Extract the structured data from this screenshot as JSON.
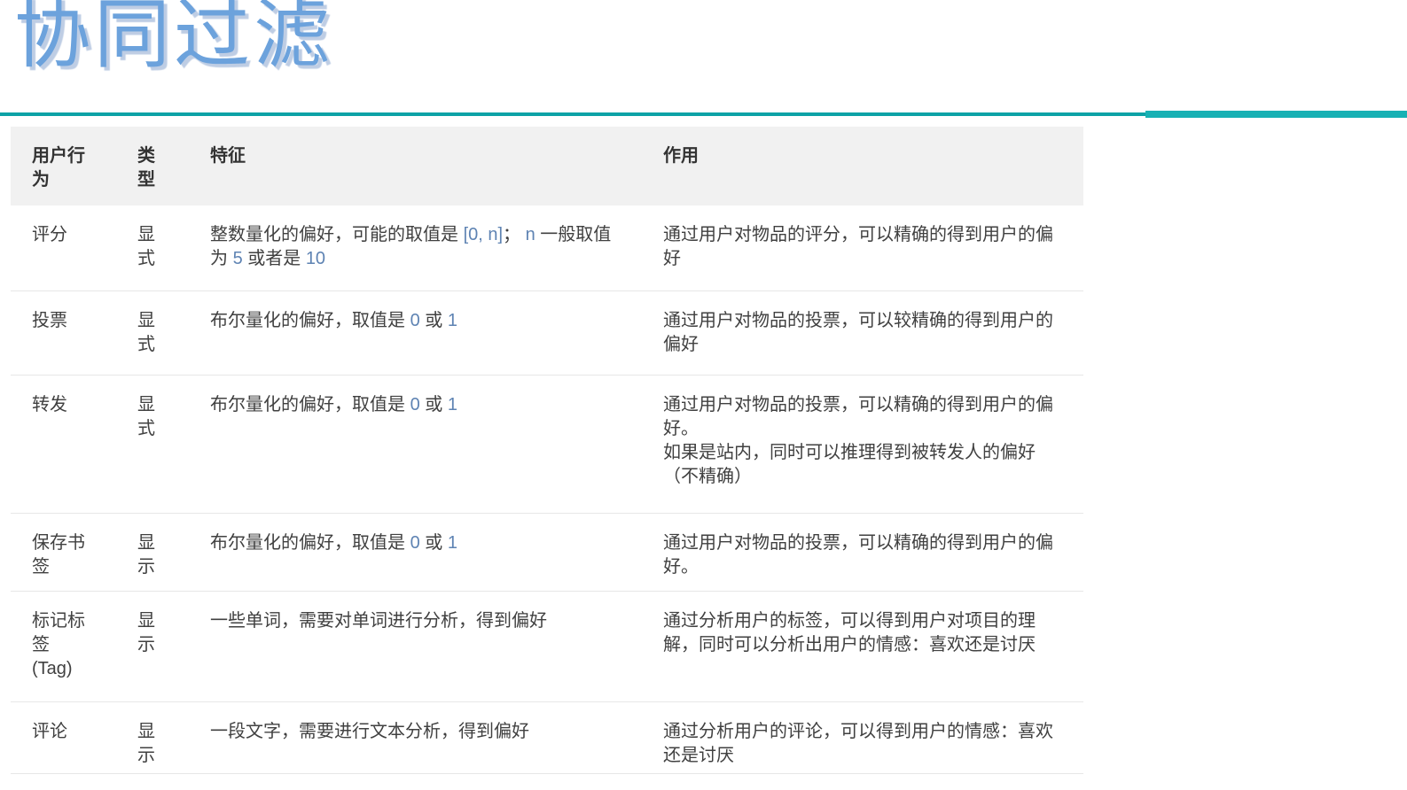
{
  "page": {
    "title": "协同过滤"
  },
  "colors": {
    "title-color": "#6ca2dc",
    "teal-left": "#0da2a6",
    "teal-right": "#17b1b4",
    "header-bg": "#f1f1f1",
    "number-color": "#5e83b3"
  },
  "table": {
    "headers": {
      "behavior": "用户行为",
      "type": "类型",
      "feature": "特征",
      "effect": "作用"
    },
    "rows": [
      {
        "behavior": "评分",
        "type": "显式",
        "feature": [
          {
            "text": "整数量化的偏好，可能的取值是 ",
            "kind": "text"
          },
          {
            "text": "[0, n]",
            "kind": "number"
          },
          {
            "text": "； ",
            "kind": "text"
          },
          {
            "text": "n",
            "kind": "number"
          },
          {
            "text": " 一般取值为 ",
            "kind": "text"
          },
          {
            "text": "5",
            "kind": "number"
          },
          {
            "text": " 或者是 ",
            "kind": "text"
          },
          {
            "text": "10",
            "kind": "number"
          }
        ],
        "effect": "通过用户对物品的评分，可以精确的得到用户的偏好"
      },
      {
        "behavior": "投票",
        "type": "显式",
        "feature": [
          {
            "text": "布尔量化的偏好，取值是 ",
            "kind": "text"
          },
          {
            "text": "0",
            "kind": "number"
          },
          {
            "text": " 或 ",
            "kind": "text"
          },
          {
            "text": "1",
            "kind": "number"
          }
        ],
        "effect": "通过用户对物品的投票，可以较精确的得到用户的偏好"
      },
      {
        "behavior": "转发",
        "type": "显式",
        "feature": [
          {
            "text": "布尔量化的偏好，取值是 ",
            "kind": "text"
          },
          {
            "text": "0",
            "kind": "number"
          },
          {
            "text": " 或 ",
            "kind": "text"
          },
          {
            "text": "1",
            "kind": "number"
          }
        ],
        "effect": "通过用户对物品的投票，可以精确的得到用户的偏好。\n如果是站内，同时可以推理得到被转发人的偏好（不精确）"
      },
      {
        "behavior": "保存书签",
        "type": "显示",
        "feature": [
          {
            "text": "布尔量化的偏好，取值是 ",
            "kind": "text"
          },
          {
            "text": "0",
            "kind": "number"
          },
          {
            "text": " 或 ",
            "kind": "text"
          },
          {
            "text": "1",
            "kind": "number"
          }
        ],
        "effect": "通过用户对物品的投票，可以精确的得到用户的偏好。"
      },
      {
        "behavior": "标记标签\n(Tag)",
        "type": "显示",
        "feature": [
          {
            "text": "一些单词，需要对单词进行分析，得到偏好",
            "kind": "text"
          }
        ],
        "effect": "通过分析用户的标签，可以得到用户对项目的理解，同时可以分析出用户的情感：喜欢还是讨厌"
      },
      {
        "behavior": "评论",
        "type": "显示",
        "feature": [
          {
            "text": "一段文字，需要进行文本分析，得到偏好",
            "kind": "text"
          }
        ],
        "effect": "通过分析用户的评论，可以得到用户的情感：喜欢还是讨厌"
      }
    ]
  }
}
